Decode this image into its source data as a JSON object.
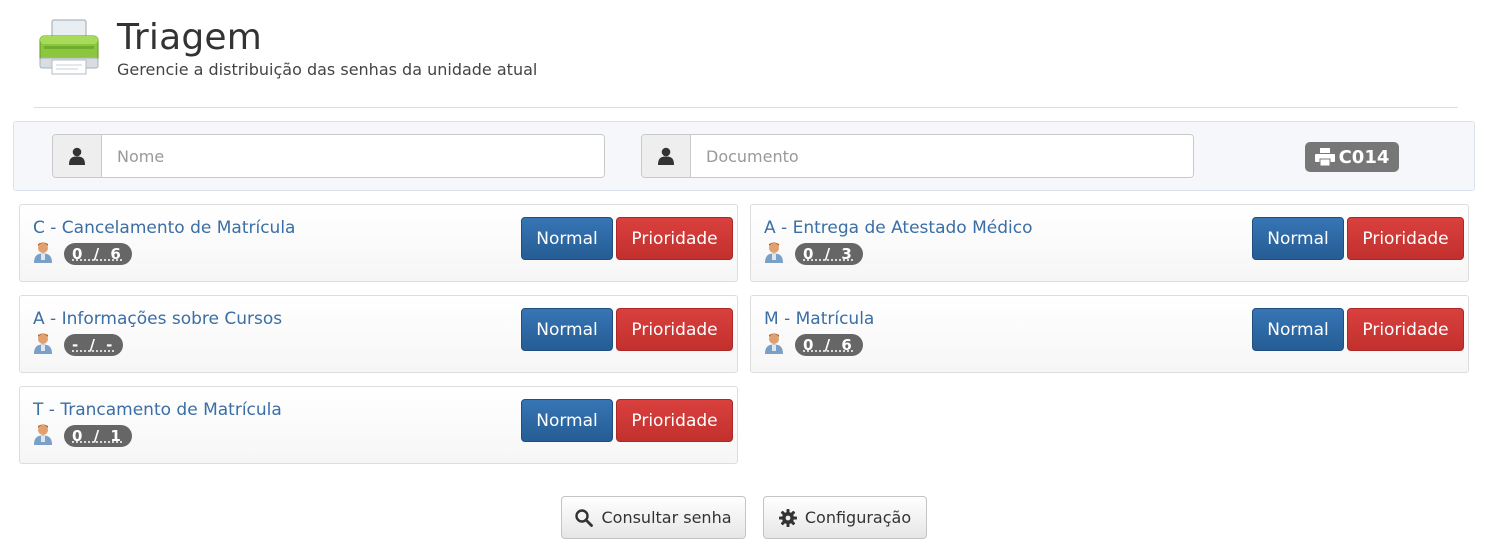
{
  "header": {
    "title": "Triagem",
    "subtitle": "Gerencie a distribuição das senhas da unidade atual",
    "icon": "printer-icon"
  },
  "form": {
    "name_placeholder": "Nome",
    "document_placeholder": "Documento",
    "ticket_label": "C014",
    "user_icon": "user-icon",
    "ticket_icon": "print-icon"
  },
  "services": [
    {
      "title": "C - Cancelamento de Matrícula",
      "count": "0 / 6",
      "normal_label": "Normal",
      "priority_label": "Prioridade"
    },
    {
      "title": "A - Entrega de Atestado Médico",
      "count": "0 / 3",
      "normal_label": "Normal",
      "priority_label": "Prioridade"
    },
    {
      "title": "A - Informações sobre Cursos",
      "count": "- / -",
      "normal_label": "Normal",
      "priority_label": "Prioridade"
    },
    {
      "title": "M - Matrícula",
      "count": "0 / 6",
      "normal_label": "Normal",
      "priority_label": "Prioridade"
    },
    {
      "title": "T - Trancamento de Matrícula",
      "count": "0 / 1",
      "normal_label": "Normal",
      "priority_label": "Prioridade"
    }
  ],
  "footer": {
    "search_label": "Consultar senha",
    "config_label": "Configuração"
  },
  "colors": {
    "normal_button": "#2f6aa8",
    "priority_button": "#d23a37",
    "title_link": "#3a6ea5",
    "badge": "#666666"
  }
}
